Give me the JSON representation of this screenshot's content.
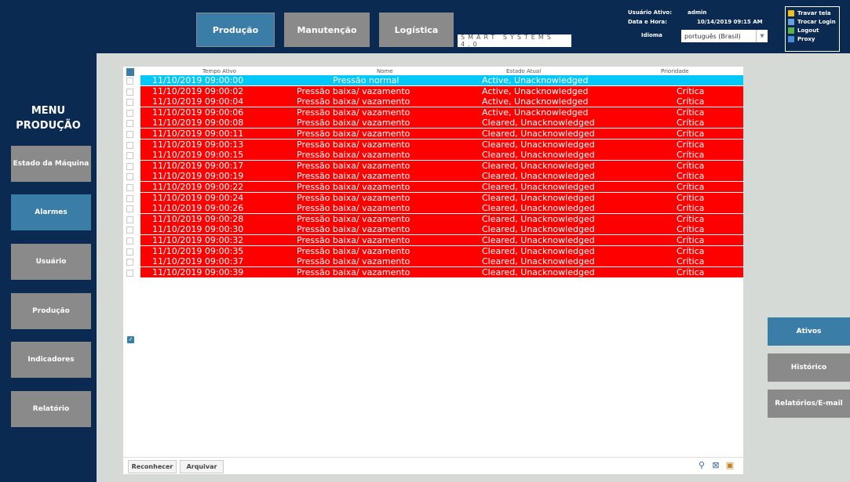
{
  "nav": {
    "producao": "Produção",
    "manutencao": "Manutenção",
    "logistica": "Logística"
  },
  "logo_text": "SMART SYSTEMS 4.0",
  "info": {
    "user_label": "Usuário Ativo:",
    "user_value": "admin",
    "datetime_label": "Data e Hora:",
    "datetime_value": "10/14/2019 09:15 AM",
    "language_label": "Idioma",
    "language_value": "português (Brasil)"
  },
  "quicklinks": {
    "lock": "Travar tela",
    "switch_login": "Trocar Login",
    "logout": "Logout",
    "proxy": "Proxy"
  },
  "menu": {
    "title_line1": "MENU",
    "title_line2": "PRODUÇÃO",
    "items": [
      "Estado da Máquina",
      "Alarmes",
      "Usuário",
      "Produção",
      "Indicadores",
      "Relatório"
    ],
    "active_index": 1
  },
  "table": {
    "headers": {
      "time": "Tempo Ativo",
      "name": "Nome",
      "state": "Estado Atual",
      "priority": "Prioridade"
    },
    "rows": [
      {
        "time": "11/10/2019 09:00:00",
        "name": "Pressão normal",
        "state": "Active, Unacknowledged",
        "priority": "",
        "severity": "normal"
      },
      {
        "time": "11/10/2019 09:00:02",
        "name": "Pressão baixa/ vazamento",
        "state": "Active, Unacknowledged",
        "priority": "Crítica",
        "severity": "alarm"
      },
      {
        "time": "11/10/2019 09:00:04",
        "name": "Pressão baixa/ vazamento",
        "state": "Active, Unacknowledged",
        "priority": "Crítica",
        "severity": "alarm"
      },
      {
        "time": "11/10/2019 09:00:06",
        "name": "Pressão baixa/ vazamento",
        "state": "Active, Unacknowledged",
        "priority": "Crítica",
        "severity": "alarm"
      },
      {
        "time": "11/10/2019 09:00:08",
        "name": "Pressão baixa/ vazamento",
        "state": "Cleared, Unacknowledged",
        "priority": "Crítica",
        "severity": "alarm"
      },
      {
        "time": "11/10/2019 09:00:11",
        "name": "Pressão baixa/ vazamento",
        "state": "Cleared, Unacknowledged",
        "priority": "Crítica",
        "severity": "alarm"
      },
      {
        "time": "11/10/2019 09:00:13",
        "name": "Pressão baixa/ vazamento",
        "state": "Cleared, Unacknowledged",
        "priority": "Crítica",
        "severity": "alarm"
      },
      {
        "time": "11/10/2019 09:00:15",
        "name": "Pressão baixa/ vazamento",
        "state": "Cleared, Unacknowledged",
        "priority": "Crítica",
        "severity": "alarm"
      },
      {
        "time": "11/10/2019 09:00:17",
        "name": "Pressão baixa/ vazamento",
        "state": "Cleared, Unacknowledged",
        "priority": "Crítica",
        "severity": "alarm"
      },
      {
        "time": "11/10/2019 09:00:19",
        "name": "Pressão baixa/ vazamento",
        "state": "Cleared, Unacknowledged",
        "priority": "Crítica",
        "severity": "alarm"
      },
      {
        "time": "11/10/2019 09:00:22",
        "name": "Pressão baixa/ vazamento",
        "state": "Cleared, Unacknowledged",
        "priority": "Crítica",
        "severity": "alarm"
      },
      {
        "time": "11/10/2019 09:00:24",
        "name": "Pressão baixa/ vazamento",
        "state": "Cleared, Unacknowledged",
        "priority": "Crítica",
        "severity": "alarm"
      },
      {
        "time": "11/10/2019 09:00:26",
        "name": "Pressão baixa/ vazamento",
        "state": "Cleared, Unacknowledged",
        "priority": "Crítica",
        "severity": "alarm"
      },
      {
        "time": "11/10/2019 09:00:28",
        "name": "Pressão baixa/ vazamento",
        "state": "Cleared, Unacknowledged",
        "priority": "Crítica",
        "severity": "alarm"
      },
      {
        "time": "11/10/2019 09:00:30",
        "name": "Pressão baixa/ vazamento",
        "state": "Cleared, Unacknowledged",
        "priority": "Crítica",
        "severity": "alarm"
      },
      {
        "time": "11/10/2019 09:00:32",
        "name": "Pressão baixa/ vazamento",
        "state": "Cleared, Unacknowledged",
        "priority": "Crítica",
        "severity": "alarm"
      },
      {
        "time": "11/10/2019 09:00:35",
        "name": "Pressão baixa/ vazamento",
        "state": "Cleared, Unacknowledged",
        "priority": "Crítica",
        "severity": "alarm"
      },
      {
        "time": "11/10/2019 09:00:37",
        "name": "Pressão baixa/ vazamento",
        "state": "Cleared, Unacknowledged",
        "priority": "Crítica",
        "severity": "alarm"
      },
      {
        "time": "11/10/2019 09:00:39",
        "name": "Pressão baixa/ vazamento",
        "state": "Cleared, Unacknowledged",
        "priority": "Crítica",
        "severity": "alarm"
      }
    ]
  },
  "footer": {
    "acknowledge": "Reconhecer",
    "archive": "Arquivar",
    "icons": [
      "search-icon",
      "export-icon",
      "settings-icon"
    ]
  },
  "rightmenu": {
    "items": [
      "Ativos",
      "Histórico",
      "Relatórios/E-mail"
    ],
    "active_index": 0
  },
  "colors": {
    "background": "#0b2a52",
    "active_button": "#3a7ea8",
    "inactive_button": "#8a8a8a",
    "alarm_row": "#ff0000",
    "normal_row": "#00c8f8"
  }
}
